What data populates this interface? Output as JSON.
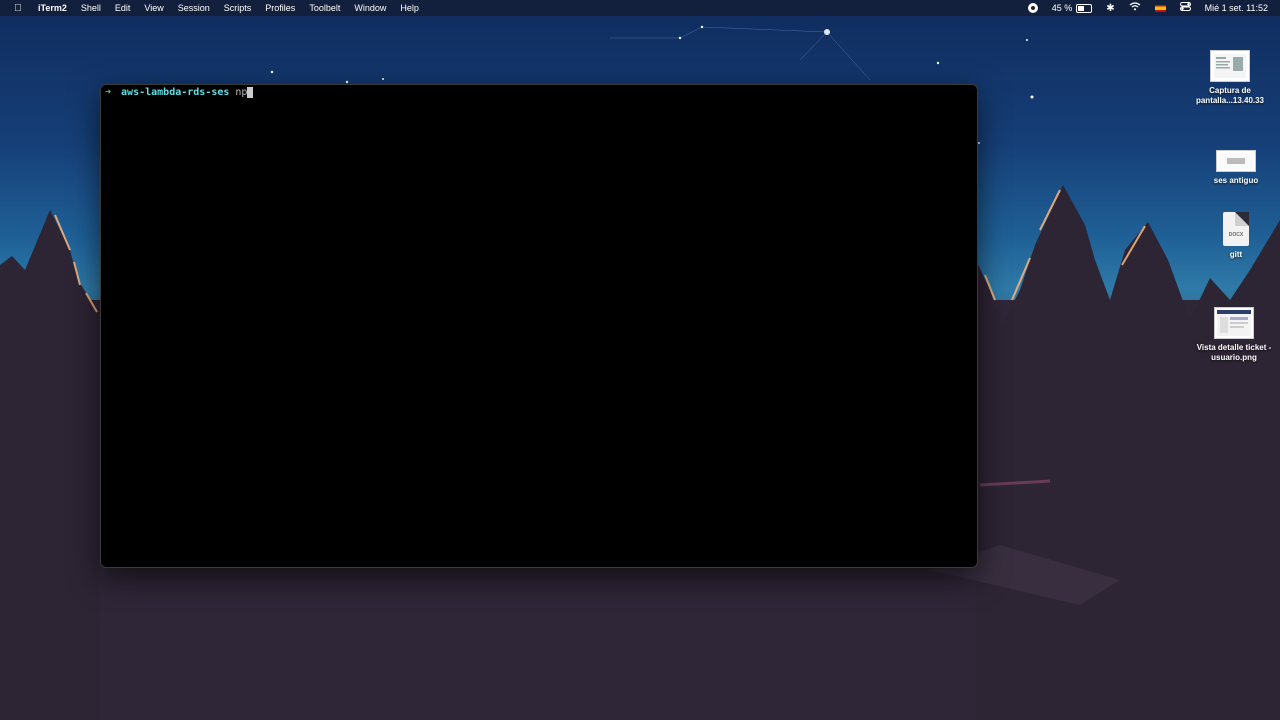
{
  "menubar": {
    "apple_icon": "apple-icon",
    "items": [
      "iTerm2",
      "Shell",
      "Edit",
      "View",
      "Session",
      "Scripts",
      "Profiles",
      "Toolbelt",
      "Window",
      "Help"
    ],
    "battery_percent": "45 %",
    "battery_level": 0.45,
    "datetime": "Mié 1 set.  11:52"
  },
  "terminal": {
    "prompt_arrow": "➜",
    "directory": "aws-lambda-rds-ses",
    "typed_text": "np"
  },
  "desktop": {
    "icons": [
      {
        "label": "Captura de pantalla...13.40.33"
      },
      {
        "label": "ses antiguo"
      },
      {
        "label": "gitt",
        "badge": "DOCX"
      },
      {
        "label": "Vista detalle ticket - usuario.png"
      }
    ]
  },
  "colors": {
    "prompt_arrow": "#3fd17a",
    "prompt_dir": "#5fe0e8",
    "terminal_bg": "#000000"
  }
}
